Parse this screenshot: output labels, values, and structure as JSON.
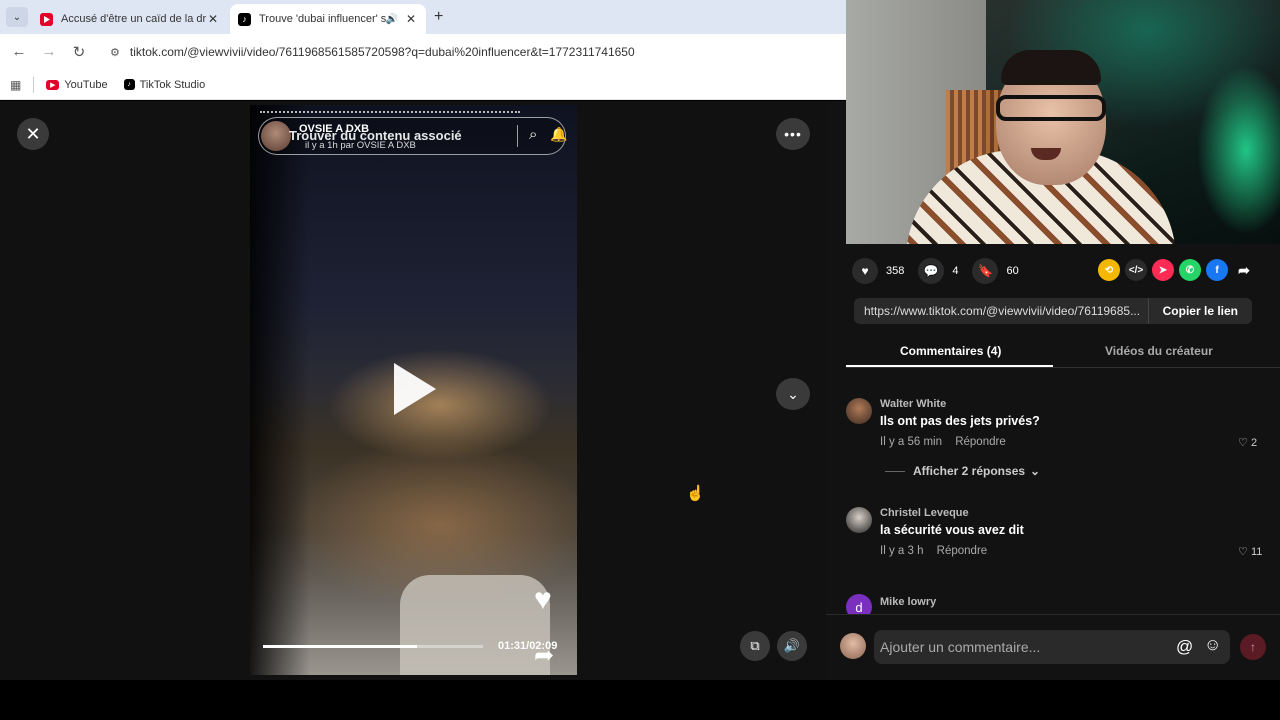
{
  "browser": {
    "tabs": [
      {
        "title": "Accusé d'être un caïd de la drogue",
        "favicon": "youtube-icon",
        "color": "#e4002b"
      },
      {
        "title": "Trouve 'dubai influencer' sur TikTok",
        "favicon": "tiktok-icon",
        "color": "#000000"
      }
    ],
    "url": "tiktok.com/@viewvivii/video/7611968561585720598?q=dubai%20influencer&t=1772311741650",
    "bookmarks": [
      {
        "label": "YouTube",
        "icon": "youtube-icon"
      },
      {
        "label": "TikTok Studio",
        "icon": "tiktok-icon"
      }
    ]
  },
  "video": {
    "author": "OVSIE A DXB",
    "overlay_title": "Trouver du contenu associé",
    "posted": "il y a 1h par OVSIE A DXB",
    "current_time": "01:31",
    "duration": "02:09",
    "time_display": "01:31/02:09",
    "progress": 0.7
  },
  "stats": {
    "likes": "358",
    "comments": "4",
    "saves": "60"
  },
  "share": {
    "link": "https://www.tiktok.com/@viewvivii/video/76119685...",
    "copy_label": "Copier le lien"
  },
  "tabs": {
    "comments": "Commentaires (4)",
    "creator_videos": "Vidéos du créateur"
  },
  "comments": [
    {
      "author": "Walter White",
      "text": "Ils ont pas des jets privés?",
      "time": "Il y a 56 min",
      "reply": "Répondre",
      "likes": "2"
    },
    {
      "author": "Christel Leveque",
      "text": "la sécurité vous avez dit",
      "time": "Il y a 3 h",
      "reply": "Répondre",
      "likes": "11"
    },
    {
      "author": "Mike lowry",
      "initial": "d"
    }
  ],
  "replies_toggle": "Afficher 2 réponses",
  "compose": {
    "placeholder": "Ajouter un commentaire..."
  },
  "colors": {
    "accent": "#fe2c55",
    "panel_bg": "#121212"
  }
}
